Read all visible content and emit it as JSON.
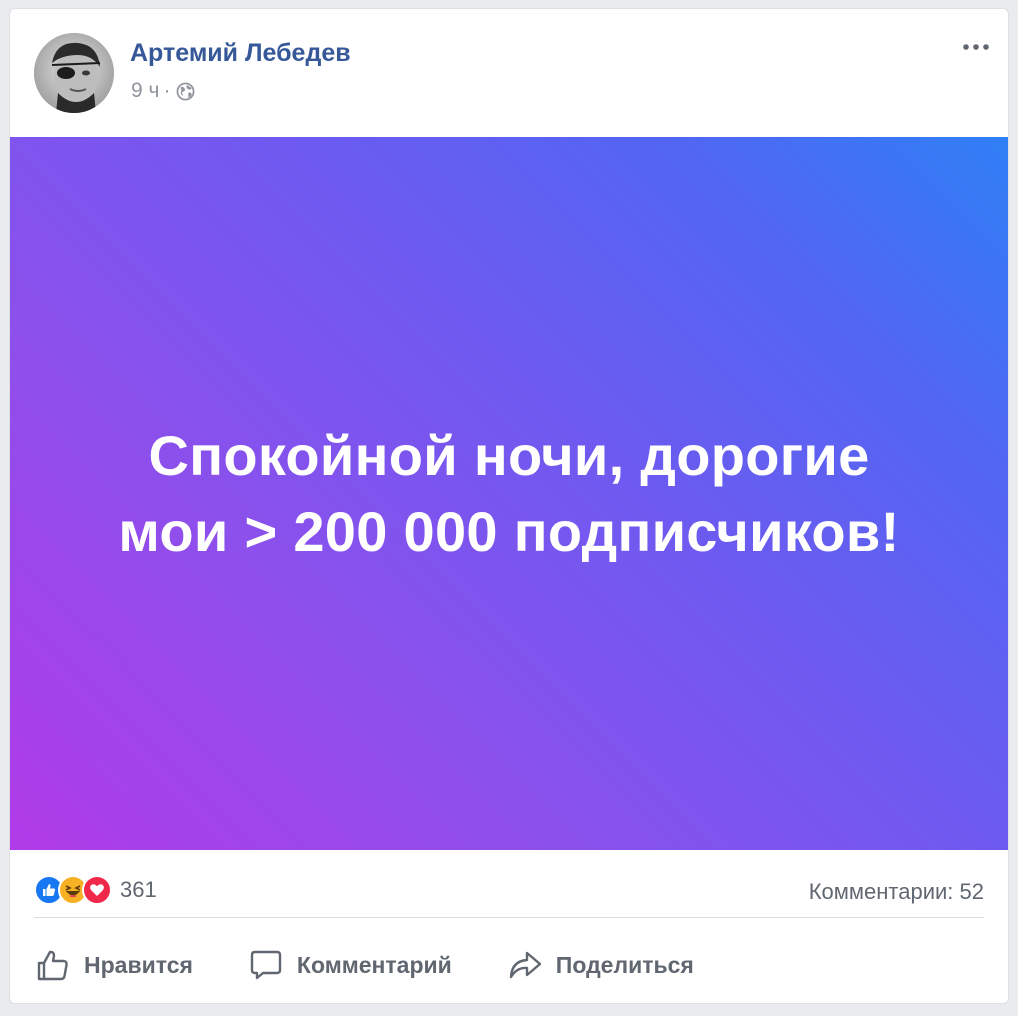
{
  "post": {
    "author": "Артемий Лебедев",
    "time": "9 ч",
    "separator": "·",
    "privacy_icon": "globe-icon",
    "menu_icon": "more-icon",
    "text": "Спокойной ночи, дорогие мои > 200 000 подписчиков!"
  },
  "stats": {
    "reactions": [
      "like-icon",
      "haha-icon",
      "love-icon"
    ],
    "reaction_count": "361",
    "comments": "Комментарии: 52"
  },
  "actions": {
    "like_label": "Нравится",
    "comment_label": "Комментарий",
    "share_label": "Поделиться"
  },
  "colors": {
    "link": "#365899",
    "secondary_text": "#90949c",
    "action_text": "#606770",
    "gradient_start": "#b13be8",
    "gradient_end": "#2f7ff5",
    "like_blue": "#1877f2",
    "love_red": "#f0284a",
    "haha_yellow": "#f7b125"
  }
}
